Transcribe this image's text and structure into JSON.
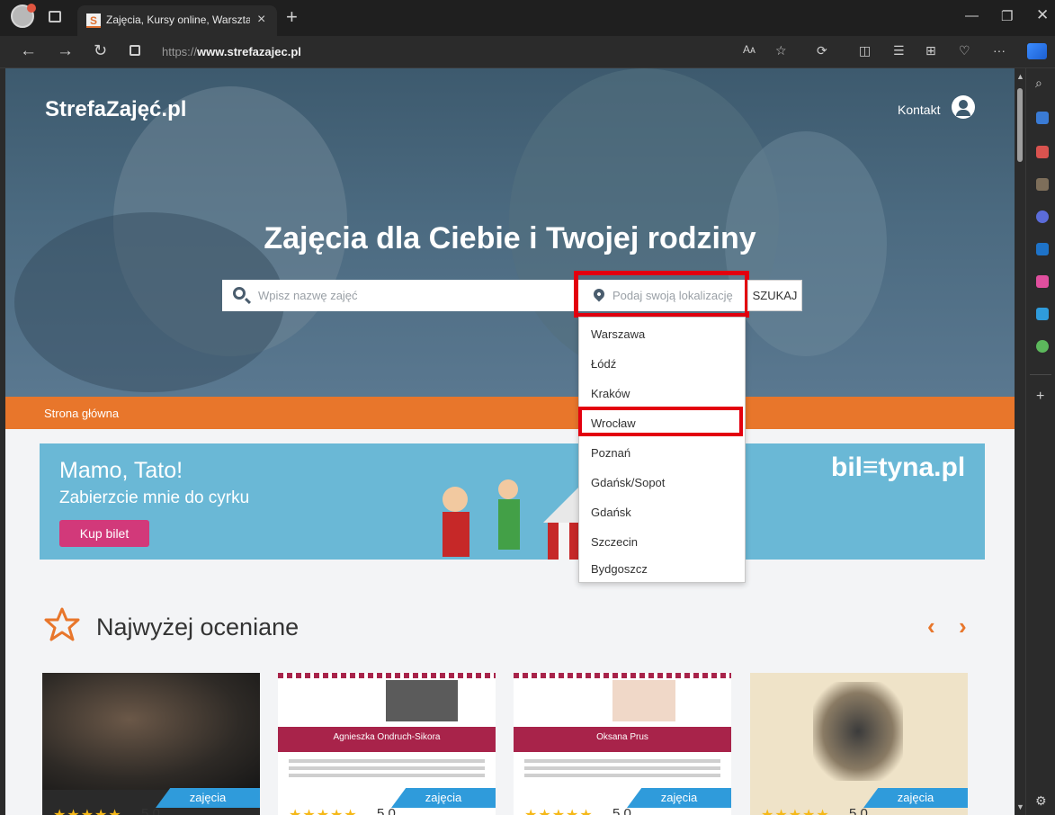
{
  "browser": {
    "tab_title": "Zajęcia, Kursy online, Warsztaty, I",
    "tab_favicon": "S",
    "url_prefix": "https://",
    "url_domain": "www.strefazajec.pl",
    "reader_label": "Aᴀ"
  },
  "site": {
    "logo": "StrefaZajęć.pl",
    "contact": "Kontakt",
    "headline": "Zajęcia dla Ciebie i Twojej rodziny",
    "search_placeholder": "Wpisz nazwę zajęć",
    "location_placeholder": "Podaj swoją lokalizację",
    "search_button": "SZUKAJ",
    "breadcrumb": "Strona główna"
  },
  "location_dropdown": {
    "items": [
      "Warszawa",
      "Łódź",
      "Kraków",
      "Wrocław",
      "Poznań",
      "Gdańsk/Sopot",
      "Gdańsk",
      "Szczecin",
      "Bydgoszcz"
    ],
    "highlighted": "Kraków"
  },
  "banner": {
    "line1": "Mamo, Tato!",
    "line2": "Zabierzcie mnie do cyrku",
    "button": "Kup bilet",
    "brand": "bil≡tyna.pl"
  },
  "top_rated": {
    "title": "Najwyżej oceniane",
    "cards": [
      {
        "tag": "zajęcia",
        "rating": "5.0"
      },
      {
        "tag": "zajęcia",
        "rating": "5.0",
        "name": "Agnieszka Ondruch-Sikora"
      },
      {
        "tag": "zajęcia",
        "rating": "5.0",
        "name": "Oksana Prus"
      },
      {
        "tag": "zajęcia",
        "rating": "5.0"
      }
    ]
  },
  "colors": {
    "accent_orange": "#e8762b",
    "tag_blue": "#2f9bdb",
    "highlight_red": "#e3000f",
    "banner_blue": "#6ab8d6"
  }
}
